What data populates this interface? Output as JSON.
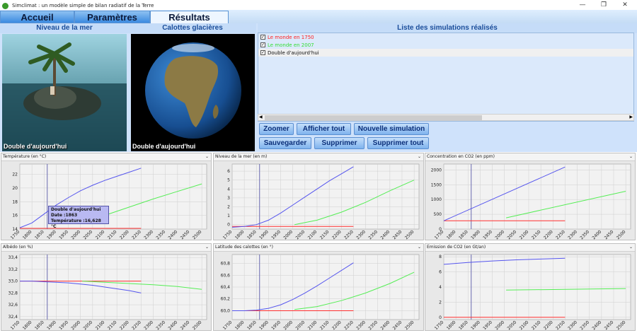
{
  "window": {
    "title": "Simclimat : un modèle simple de bilan radiatif de la Terre",
    "minimize": "—",
    "maximize": "❐",
    "close": "✕"
  },
  "tabs": [
    {
      "label": "Accueil"
    },
    {
      "label": "Paramètres"
    },
    {
      "label": "Résultats"
    }
  ],
  "panels": {
    "sea_level": {
      "header": "Niveau de la mer",
      "caption": "Double d'aujourd'hui"
    },
    "ice_caps": {
      "header": "Calottes glacières",
      "caption": "Double d'aujourd'hui"
    },
    "simulations": {
      "header": "Liste des simulations réalisés"
    }
  },
  "simulations": [
    {
      "label": "Le monde en 1750",
      "color": "#ff2020",
      "checked": true
    },
    {
      "label": "Le monde en 2007",
      "color": "#33dd33",
      "checked": true
    },
    {
      "label": "Double d'aujourd'hui",
      "color": "#111111",
      "checked": true
    }
  ],
  "buttons": {
    "zoom": "Zoomer",
    "show_all": "Afficher tout",
    "new_sim": "Nouvelle simulation",
    "save": "Sauvegarder",
    "delete": "Supprimer",
    "delete_all": "Supprimer tout"
  },
  "tooltip": {
    "line1": "Double d'aujourd'hui",
    "line2": "Date :1863",
    "line3": "Température :16,628 °C"
  },
  "chart_data": [
    {
      "type": "line",
      "title": "Température (en °C)",
      "xticks": [
        1750,
        1800,
        1850,
        1900,
        1950,
        2000,
        2050,
        2100,
        2150,
        2200,
        2250,
        2300,
        2350,
        2400,
        2450,
        2500
      ],
      "yticks": [
        "14",
        "16",
        "18",
        "20",
        "22"
      ],
      "ylim": [
        14,
        23.5
      ],
      "cursor_x": 1863,
      "grid": true,
      "series": [
        {
          "color": "#ff3030",
          "x": [
            1750,
            2250
          ],
          "y": [
            14.1,
            14.1
          ]
        },
        {
          "color": "#5555ee",
          "x": [
            1750,
            1800,
            1850,
            1900,
            1950,
            2000,
            2050,
            2100,
            2150,
            2200,
            2250
          ],
          "y": [
            14.2,
            14.9,
            16.2,
            17.5,
            18.6,
            19.6,
            20.4,
            21.1,
            21.7,
            22.3,
            22.9
          ]
        },
        {
          "color": "#55ee55",
          "x": [
            2007,
            2100,
            2200,
            2300,
            2400,
            2500
          ],
          "y": [
            14.8,
            16.0,
            17.2,
            18.4,
            19.5,
            20.6
          ]
        }
      ]
    },
    {
      "type": "line",
      "title": "Niveau de la mer (en m)",
      "xticks": [
        1750,
        1800,
        1850,
        1900,
        1950,
        2000,
        2050,
        2100,
        2150,
        2200,
        2250,
        2300,
        2350,
        2400,
        2450,
        2500
      ],
      "yticks": [
        "0",
        "1",
        "2",
        "3",
        "4",
        "5",
        "6"
      ],
      "ylim": [
        -0.5,
        6.8
      ],
      "cursor_x": 1863,
      "grid": true,
      "series": [
        {
          "color": "#ff3030",
          "x": [
            1750,
            2250
          ],
          "y": [
            -0.2,
            -0.2
          ]
        },
        {
          "color": "#5555ee",
          "x": [
            1750,
            1800,
            1850,
            1900,
            1950,
            2000,
            2050,
            2100,
            2150,
            2200,
            2250
          ],
          "y": [
            -0.3,
            -0.2,
            0.0,
            0.5,
            1.3,
            2.2,
            3.1,
            4.0,
            4.9,
            5.7,
            6.5
          ]
        },
        {
          "color": "#55ee55",
          "x": [
            2007,
            2100,
            2200,
            2300,
            2400,
            2500
          ],
          "y": [
            0.0,
            0.5,
            1.4,
            2.5,
            3.8,
            5.0
          ]
        }
      ]
    },
    {
      "type": "line",
      "title": "Concentration en CO2 (en ppm)",
      "xticks": [
        1750,
        1800,
        1850,
        1900,
        1950,
        2000,
        2050,
        2100,
        2150,
        2200,
        2250,
        2300,
        2350,
        2400,
        2450,
        2500
      ],
      "yticks": [
        "0",
        "500",
        "1000",
        "1500",
        "2000"
      ],
      "ylim": [
        0,
        2200
      ],
      "cursor_x": 1863,
      "grid": true,
      "series": [
        {
          "color": "#ff3030",
          "x": [
            1750,
            2250
          ],
          "y": [
            280,
            280
          ]
        },
        {
          "color": "#5555ee",
          "x": [
            1750,
            2250
          ],
          "y": [
            280,
            2100
          ]
        },
        {
          "color": "#55ee55",
          "x": [
            2007,
            2500
          ],
          "y": [
            380,
            1280
          ]
        }
      ]
    },
    {
      "type": "line",
      "title": "Albédo (en %)",
      "xticks": [
        1750,
        1800,
        1850,
        1900,
        1950,
        2000,
        2050,
        2100,
        2150,
        2200,
        2250,
        2300,
        2350,
        2400,
        2450,
        2500
      ],
      "yticks": [
        "32,4",
        "32,6",
        "32,8",
        "33,0",
        "33,2",
        "33,4"
      ],
      "ylim": [
        32.35,
        33.45
      ],
      "cursor_x": 1863,
      "grid": true,
      "series": [
        {
          "color": "#ff3030",
          "x": [
            1750,
            2250
          ],
          "y": [
            33.0,
            33.0
          ]
        },
        {
          "color": "#5555ee",
          "x": [
            1750,
            1800,
            1850,
            1900,
            1950,
            2000,
            2050,
            2100,
            2150,
            2200,
            2250
          ],
          "y": [
            33.0,
            33.0,
            32.99,
            32.98,
            32.97,
            32.95,
            32.93,
            32.9,
            32.87,
            32.84,
            32.8
          ]
        },
        {
          "color": "#55ee55",
          "x": [
            2007,
            2100,
            2200,
            2300,
            2400,
            2500
          ],
          "y": [
            33.0,
            32.98,
            32.96,
            32.94,
            32.91,
            32.86
          ]
        }
      ]
    },
    {
      "type": "line",
      "title": "Latitude des calottes (en °)",
      "xticks": [
        1750,
        1800,
        1850,
        1900,
        1950,
        2000,
        2050,
        2100,
        2150,
        2200,
        2250,
        2300,
        2350,
        2400,
        2450,
        2500
      ],
      "yticks": [
        "60,0",
        "60,2",
        "60,4",
        "60,6",
        "60,8"
      ],
      "ylim": [
        59.85,
        60.95
      ],
      "cursor_x": 1863,
      "grid": true,
      "series": [
        {
          "color": "#ff3030",
          "x": [
            1750,
            2250
          ],
          "y": [
            60.0,
            60.0
          ]
        },
        {
          "color": "#5555ee",
          "x": [
            1750,
            1800,
            1850,
            1900,
            1950,
            2000,
            2050,
            2100,
            2150,
            2200,
            2250
          ],
          "y": [
            60.0,
            60.0,
            60.01,
            60.04,
            60.1,
            60.19,
            60.3,
            60.42,
            60.55,
            60.68,
            60.81
          ]
        },
        {
          "color": "#55ee55",
          "x": [
            2007,
            2100,
            2200,
            2300,
            2400,
            2500
          ],
          "y": [
            60.02,
            60.07,
            60.17,
            60.3,
            60.46,
            60.65
          ]
        }
      ]
    },
    {
      "type": "line",
      "title": "Emission de CO2 (en Gt/an)",
      "xticks": [
        1750,
        1800,
        1850,
        1900,
        1950,
        2000,
        2050,
        2100,
        2150,
        2200,
        2250,
        2300,
        2350,
        2400,
        2450,
        2500
      ],
      "yticks": [
        "0",
        "2",
        "4",
        "6",
        "8"
      ],
      "ylim": [
        -0.3,
        8.3
      ],
      "cursor_x": 1863,
      "grid": true,
      "series": [
        {
          "color": "#ff3030",
          "x": [
            1750,
            2250
          ],
          "y": [
            0,
            0
          ]
        },
        {
          "color": "#5555ee",
          "x": [
            1750,
            1850,
            1950,
            2050,
            2150,
            2250
          ],
          "y": [
            7.0,
            7.25,
            7.45,
            7.6,
            7.7,
            7.8
          ]
        },
        {
          "color": "#55ee55",
          "x": [
            2007,
            2500
          ],
          "y": [
            3.6,
            3.8
          ]
        }
      ]
    }
  ]
}
